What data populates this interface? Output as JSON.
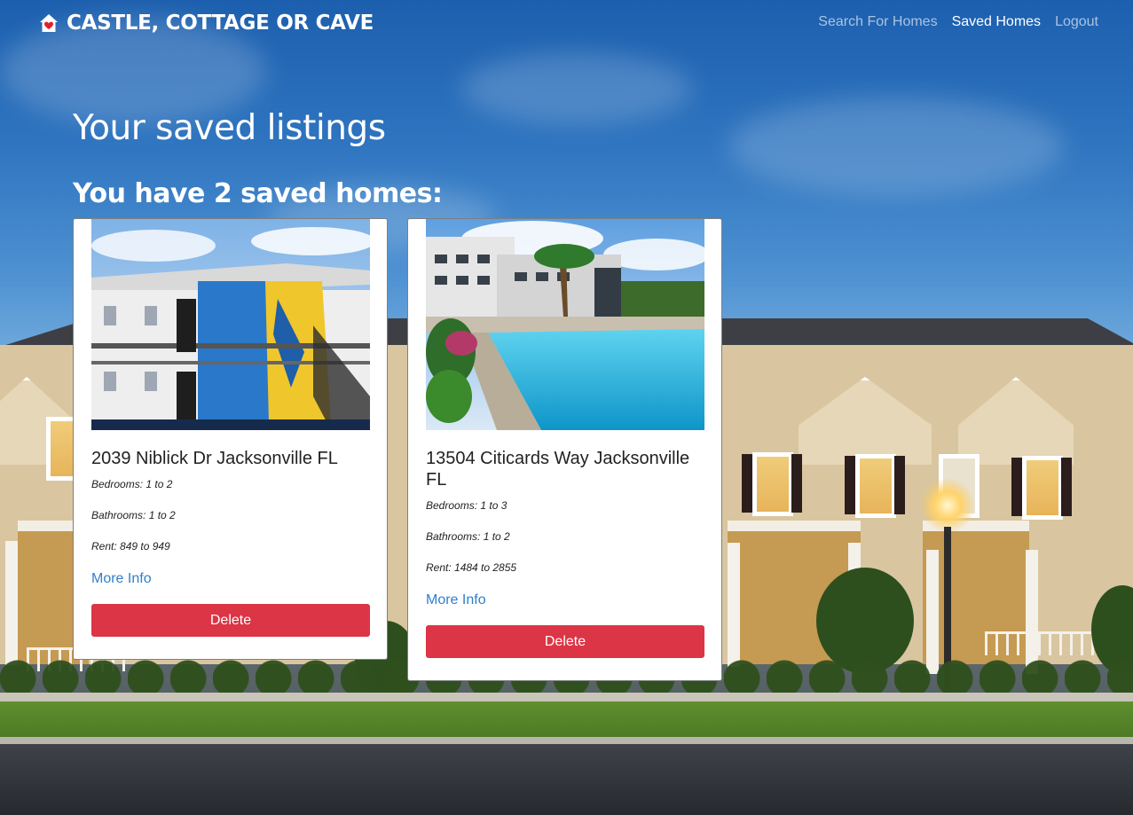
{
  "brand": {
    "name": "CASTLE, COTTAGE OR CAVE",
    "logo_icon": "house-heart-icon",
    "logo_color": "#e0202c"
  },
  "nav": {
    "links": [
      {
        "label": "Search For Homes",
        "active": false
      },
      {
        "label": "Saved Homes",
        "active": true
      },
      {
        "label": "Logout",
        "active": false
      }
    ]
  },
  "page": {
    "title": "Your saved listings",
    "count_heading": "You have 2 saved homes:"
  },
  "listings": [
    {
      "address": "2039 Niblick Dr Jacksonville FL",
      "bedrooms": "Bedrooms: 1 to 2",
      "bathrooms": "Bathrooms: 1 to 2",
      "rent": "Rent: 849 to 949",
      "link_label": "More Info",
      "delete_label": "Delete"
    },
    {
      "address": "13504 Citicards Way Jacksonville FL",
      "bedrooms": "Bedrooms: 1 to 3",
      "bathrooms": "Bathrooms: 1 to 2",
      "rent": "Rent: 1484 to 2855",
      "link_label": "More Info",
      "delete_label": "Delete"
    }
  ],
  "colors": {
    "delete_button": "#dc3545",
    "link": "#2f7fcd",
    "nav_active": "#ffffff"
  }
}
